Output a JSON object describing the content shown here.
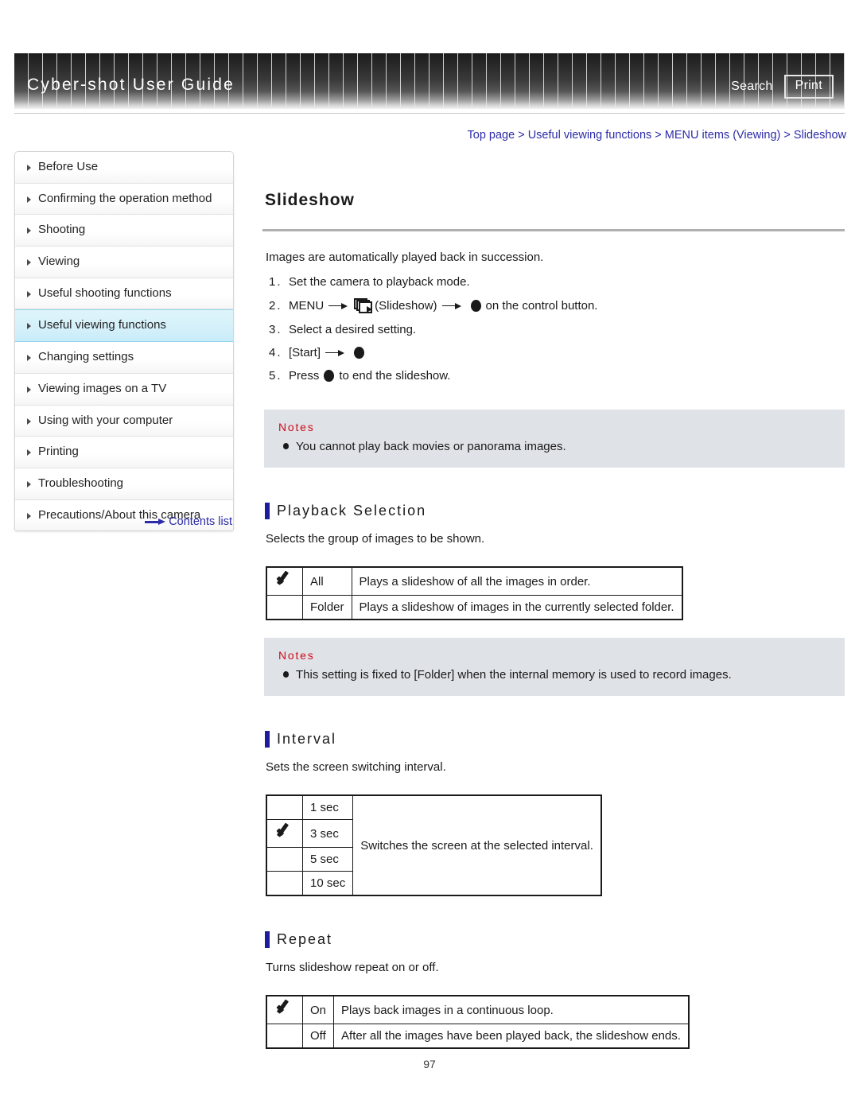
{
  "header": {
    "title": "Cyber-shot User Guide",
    "search_label": "Search",
    "print_label": "Print"
  },
  "breadcrumb": {
    "separator": ">",
    "items": [
      {
        "label": "Top page"
      },
      {
        "label": "Useful viewing functions"
      },
      {
        "label": "MENU items (Viewing)"
      },
      {
        "label": "Slideshow"
      }
    ]
  },
  "sidebar": {
    "items": [
      {
        "label": "Before Use",
        "selected": false
      },
      {
        "label": "Confirming the operation method",
        "selected": false
      },
      {
        "label": "Shooting",
        "selected": false
      },
      {
        "label": "Viewing",
        "selected": false
      },
      {
        "label": "Useful shooting functions",
        "selected": false
      },
      {
        "label": "Useful viewing functions",
        "selected": true
      },
      {
        "label": "Changing settings",
        "selected": false
      },
      {
        "label": "Viewing images on a TV",
        "selected": false
      },
      {
        "label": "Using with your computer",
        "selected": false
      },
      {
        "label": "Printing",
        "selected": false
      },
      {
        "label": "Troubleshooting",
        "selected": false
      },
      {
        "label": "Precautions/About this camera",
        "selected": false
      }
    ],
    "contents_link": "Contents list"
  },
  "main": {
    "page_title": "Slideshow",
    "intro": "Images are automatically played back in succession.",
    "steps": [
      {
        "no": "1.",
        "parts": [
          {
            "type": "text",
            "value": "Set the camera to playback mode."
          }
        ]
      },
      {
        "no": "2.",
        "parts": [
          {
            "type": "text",
            "value": "MENU"
          },
          {
            "type": "arrow"
          },
          {
            "type": "slideshow-icon"
          },
          {
            "type": "text",
            "value": "(Slideshow)"
          },
          {
            "type": "arrow"
          },
          {
            "type": "dot"
          },
          {
            "type": "text",
            "value": "on the control button."
          }
        ]
      },
      {
        "no": "3.",
        "parts": [
          {
            "type": "text",
            "value": "Select a desired setting."
          }
        ]
      },
      {
        "no": "4.",
        "parts": [
          {
            "type": "text",
            "value": "[Start]"
          },
          {
            "type": "arrow"
          },
          {
            "type": "dot"
          }
        ]
      },
      {
        "no": "5.",
        "parts": [
          {
            "type": "text",
            "value": "Press"
          },
          {
            "type": "dot"
          },
          {
            "type": "text",
            "value": "to end the slideshow."
          }
        ]
      }
    ],
    "notes_top": {
      "title": "Notes",
      "lines": [
        "You cannot play back movies or panorama images."
      ]
    },
    "sections": [
      {
        "title": "Playback Selection",
        "desc": "Selects the group of images to be shown.",
        "table": {
          "layout": "simple",
          "rows": [
            {
              "checked": true,
              "label": "All",
              "desc": "Plays a slideshow of all the images in order."
            },
            {
              "checked": false,
              "label": "Folder",
              "desc": "Plays a slideshow of images in the currently selected folder."
            }
          ]
        },
        "notes": {
          "title": "Notes",
          "lines": [
            "This setting is fixed to [Folder] when the internal memory is used to record images."
          ]
        }
      },
      {
        "title": "Interval",
        "desc": "Sets the screen switching interval.",
        "table": {
          "layout": "shared-desc",
          "shared_desc": "Switches the screen at the selected interval.",
          "rows": [
            {
              "checked": false,
              "label": "1 sec"
            },
            {
              "checked": true,
              "label": "3 sec"
            },
            {
              "checked": false,
              "label": "5 sec"
            },
            {
              "checked": false,
              "label": "10 sec"
            }
          ]
        }
      },
      {
        "title": "Repeat",
        "desc": "Turns slideshow repeat on or off.",
        "table": {
          "layout": "simple",
          "rows": [
            {
              "checked": true,
              "label": "On",
              "desc": "Plays back images in a continuous loop."
            },
            {
              "checked": false,
              "label": "Off",
              "desc": "After all the images have been played back, the slideshow ends."
            }
          ]
        }
      }
    ]
  },
  "footer": {
    "page_number": "97"
  }
}
